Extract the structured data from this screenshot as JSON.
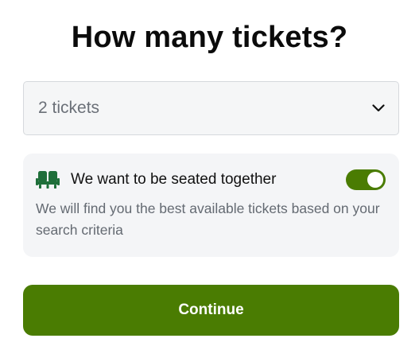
{
  "title": "How many tickets?",
  "ticket_select": {
    "value": "2 tickets",
    "icon": "chevron-down-icon"
  },
  "seating": {
    "icon": "seat-icon",
    "heading": "We want to be seated together",
    "toggle_on": true,
    "description": "We will find you the best available tickets based on your search criteria"
  },
  "continue_label": "Continue",
  "colors": {
    "accent": "#4a7c02",
    "seat_icon": "#1f6f3a"
  }
}
